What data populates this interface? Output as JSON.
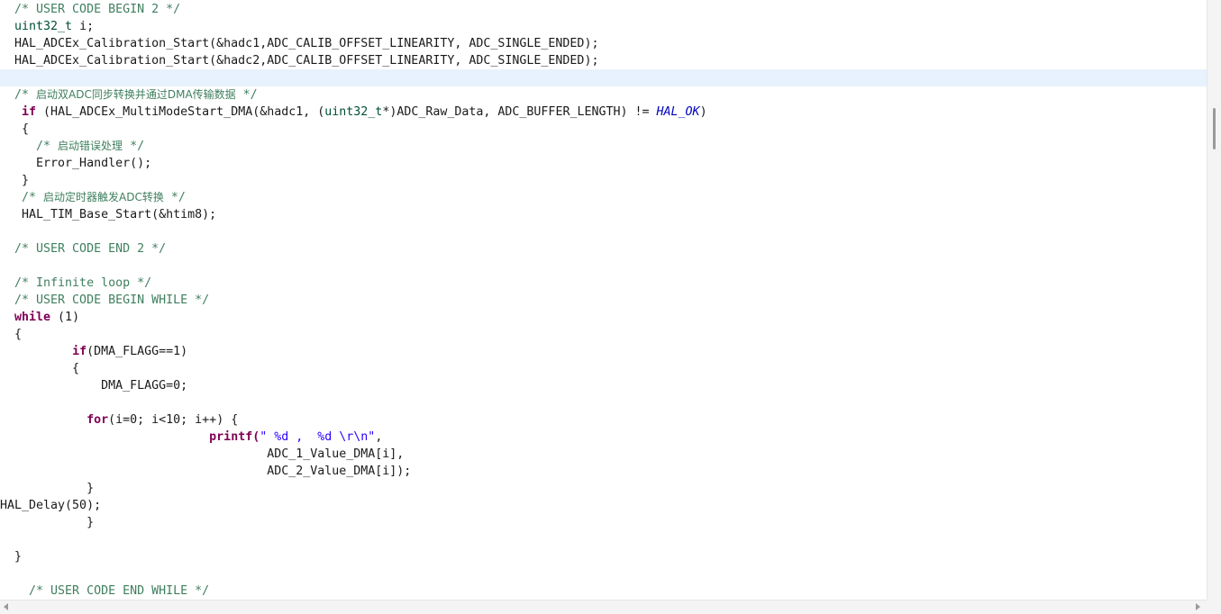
{
  "editor": {
    "line_01": "  /* USER CODE BEGIN 2 */",
    "line_02_type": "uint32_t",
    "line_02_rest": " i;",
    "line_03": "  HAL_ADCEx_Calibration_Start(&hadc1,ADC_CALIB_OFFSET_LINEARITY, ADC_SINGLE_ENDED);",
    "line_04": "  HAL_ADCEx_Calibration_Start(&hadc2,ADC_CALIB_OFFSET_LINEARITY, ADC_SINGLE_ENDED);",
    "line_05": "",
    "line_06_open": "  /* ",
    "line_06_zh": "启动双ADC同步转换并通过DMA传输数据",
    "line_06_close": " */",
    "line_07_kw": "if",
    "line_07_a": " (HAL_ADCEx_MultiModeStart_DMA(&hadc1, (",
    "line_07_type": "uint32_t",
    "line_07_b": "*)ADC_Raw_Data, ADC_BUFFER_LENGTH) != ",
    "line_07_macro": "HAL_OK",
    "line_07_c": ")",
    "line_08": "   {",
    "line_09_open": "     /* ",
    "line_09_zh": "启动错误处理",
    "line_09_close": " */",
    "line_10": "     Error_Handler();",
    "line_11": "   }",
    "line_12_open": "   /* ",
    "line_12_zh": "启动定时器触发ADC转换",
    "line_12_close": " */",
    "line_13": "   HAL_TIM_Base_Start(&htim8);",
    "line_14": "",
    "line_15": "  /* USER CODE END 2 */",
    "line_16": "",
    "line_17": "  /* Infinite loop */",
    "line_18": "  /* USER CODE BEGIN WHILE */",
    "line_19_kw": "while",
    "line_19_rest": " (1)",
    "line_20": "  {",
    "line_21_kw": "if",
    "line_21_rest": "(DMA_FLAGG==1)",
    "line_22": "          {",
    "line_23": "              DMA_FLAGG=0;",
    "line_24": "",
    "line_25_kw": "for",
    "line_25_rest": "(i=0; i<10; i++) {",
    "line_26_fn": "printf(",
    "line_26_str": "\" %d ,  %d \\r\\n\"",
    "line_26_end": ",",
    "line_27": "                                     ADC_1_Value_DMA[i],",
    "line_28": "                                     ADC_2_Value_DMA[i]);",
    "line_29": "",
    "line_30": "            }",
    "line_31": "HAL_Delay(50);",
    "line_32": "            }",
    "line_33": "",
    "line_34": "",
    "line_35": "  }",
    "line_36": "",
    "line_37": "    /* USER CODE END WHILE */"
  },
  "colors": {
    "comment": "#3f7f5f",
    "keyword": "#7f0055",
    "type": "#005032",
    "string": "#2a00ff",
    "macro": "#0000c0",
    "current_line": "#e8f2fe"
  }
}
